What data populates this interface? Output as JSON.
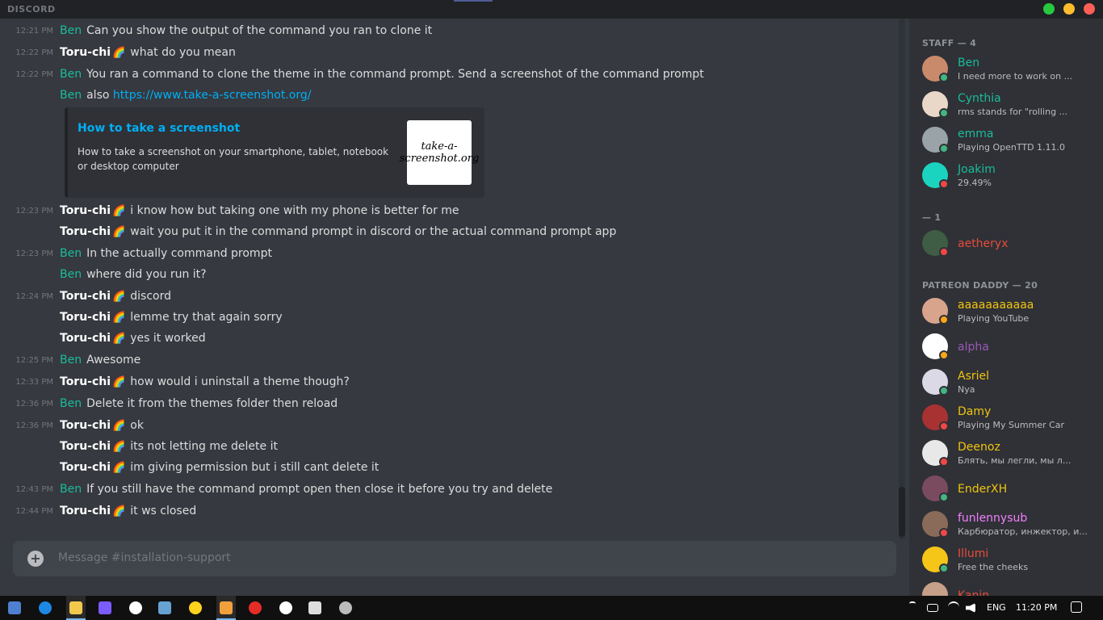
{
  "app": {
    "brand": "DISCORD"
  },
  "colors": {
    "ben": "#1abc9c",
    "toru": "#ffffff",
    "link": "#00aff4",
    "online": "#43b581",
    "dnd": "#f04747",
    "idle": "#faa61a"
  },
  "messages": [
    {
      "time": "12:21 PM",
      "author": "Ben",
      "text": "Can you show the output of the command you ran to clone it"
    },
    {
      "time": "12:22 PM",
      "author": "Toru-chi",
      "text": "what do you mean"
    },
    {
      "time": "12:22 PM",
      "author": "Ben",
      "text": "You ran a command to clone the theme in the command prompt. Send a screenshot of the command prompt"
    },
    {
      "time": "",
      "author": "Ben",
      "text": "also",
      "link": "https://www.take-a-screenshot.org/"
    },
    {
      "time": "12:23 PM",
      "author": "Toru-chi",
      "text": "i know how but taking one with my phone is better for me"
    },
    {
      "time": "",
      "author": "Toru-chi",
      "text": "wait you put it in the command prompt in discord or the actual command prompt app"
    },
    {
      "time": "12:23 PM",
      "author": "Ben",
      "text": "In the actually command prompt"
    },
    {
      "time": "",
      "author": "Ben",
      "text": "where did you run it?"
    },
    {
      "time": "12:24 PM",
      "author": "Toru-chi",
      "text": "discord"
    },
    {
      "time": "",
      "author": "Toru-chi",
      "text": "lemme try that again sorry"
    },
    {
      "time": "",
      "author": "Toru-chi",
      "text": "yes it worked"
    },
    {
      "time": "12:25 PM",
      "author": "Ben",
      "text": "Awesome"
    },
    {
      "time": "12:33 PM",
      "author": "Toru-chi",
      "text": "how would i uninstall a theme though?"
    },
    {
      "time": "12:36 PM",
      "author": "Ben",
      "text": "Delete it from the themes folder then reload"
    },
    {
      "time": "12:36 PM",
      "author": "Toru-chi",
      "text": "ok"
    },
    {
      "time": "",
      "author": "Toru-chi",
      "text": "its not letting me delete it"
    },
    {
      "time": "",
      "author": "Toru-chi",
      "text": "im giving permission but i still cant delete it"
    },
    {
      "time": "12:43 PM",
      "author": "Ben",
      "text": "If you still have the command prompt open then close it before you try and delete"
    },
    {
      "time": "12:44 PM",
      "author": "Toru-chi",
      "text": "it ws closed"
    }
  ],
  "embed": {
    "title": "How to take a screenshot",
    "description": "How to take a screenshot on your smartphone, tablet, notebook or desktop computer",
    "thumb_text": "take-a-screenshot.org"
  },
  "composer": {
    "placeholder": "Message #installation-support"
  },
  "members": {
    "groups": [
      {
        "header": "STAFF — 4",
        "items": [
          {
            "name": "Ben",
            "activity": "I need more to work on ...",
            "color": "#1abc9c",
            "status": "online",
            "avatar": "#c98a6b"
          },
          {
            "name": "Cynthia",
            "activity": "rms stands for \"rolling ...",
            "color": "#1abc9c",
            "status": "online",
            "avatar": "#e9d8c8"
          },
          {
            "name": "emma",
            "activity": "Playing OpenTTD 1.11.0",
            "color": "#1abc9c",
            "status": "online",
            "avatar": "#9aa4a8"
          },
          {
            "name": "Joakim",
            "activity": "29.49%",
            "color": "#1abc9c",
            "status": "dnd",
            "avatar": "#1bd4c0"
          }
        ]
      },
      {
        "header": "— 1",
        "items": [
          {
            "name": "aetheryx",
            "activity": "",
            "color": "#e74c3c",
            "status": "dnd",
            "avatar": "#3f5c44"
          }
        ]
      },
      {
        "header": "PATREON DADDY — 20",
        "items": [
          {
            "name": "aaaaaaaaaaa",
            "activity": "Playing YouTube",
            "color": "#f1c40f",
            "status": "idle",
            "avatar": "#d9a48c"
          },
          {
            "name": "alpha",
            "activity": "",
            "color": "#9b59b6",
            "status": "idle",
            "avatar": "#ffffff"
          },
          {
            "name": "Asriel",
            "activity": "Nya",
            "color": "#f1c40f",
            "status": "online",
            "avatar": "#dcd9e6"
          },
          {
            "name": "Damy",
            "activity": "Playing My Summer Car",
            "color": "#f1c40f",
            "status": "dnd",
            "avatar": "#a83232"
          },
          {
            "name": "Deenoz",
            "activity": "Блять, мы легли, мы л...",
            "color": "#f1c40f",
            "status": "dnd",
            "avatar": "#e8e8e8"
          },
          {
            "name": "EnderXH",
            "activity": "",
            "color": "#f1c40f",
            "status": "online",
            "avatar": "#7a4b5e"
          },
          {
            "name": "funlennysub",
            "activity": "Карбюратор, инжектор, и...",
            "color": "#f47fff",
            "status": "dnd",
            "avatar": "#8a6b5a"
          },
          {
            "name": "Illumi",
            "activity": "Free the cheeks",
            "color": "#e74c3c",
            "status": "online",
            "avatar": "#f5c518"
          },
          {
            "name": "Kanin",
            "activity": "",
            "color": "#e74c3c",
            "status": "dnd",
            "avatar": "#c7a08a"
          }
        ]
      }
    ]
  },
  "taskbar": {
    "lang": "ENG",
    "time": "11:20 PM"
  }
}
